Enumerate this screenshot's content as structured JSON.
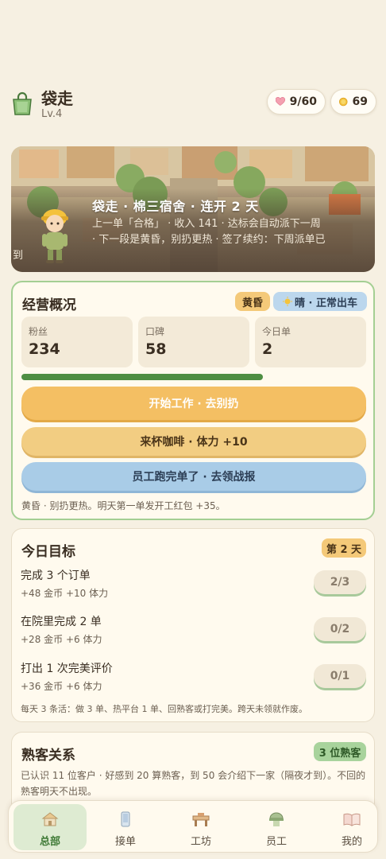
{
  "header": {
    "title": "袋走",
    "level": "Lv.4",
    "hearts": "9/60",
    "coins": "69"
  },
  "hero": {
    "title": "袋走 · 棉三宿舍 · 连开 2 天",
    "desc_line1": "上一单「合格」 · 收入 141 · 达标会自动派下一周",
    "desc_line2": "· 下一段是黄昏，别扔更热 · 签了续约：下周派单已",
    "desc_line3": "到"
  },
  "overview": {
    "title": "经营概况",
    "time_tag": "黄昏",
    "weather_tag": "晴 · 正常出车",
    "stats": [
      {
        "label": "粉丝",
        "value": "234"
      },
      {
        "label": "口碑",
        "value": "58"
      },
      {
        "label": "今日单",
        "value": "2"
      }
    ],
    "progress": 0.7,
    "start_button": "开始工作 · 去别扔",
    "coffee_button": "来杯咖啡 · 体力 +10",
    "staff_button": "员工跑完单了 · 去领战报",
    "note": "黄昏 · 别扔更热。明天第一单发开工红包 +35。"
  },
  "goals": {
    "title": "今日目标",
    "day_tag": "第 2 天",
    "items": [
      {
        "name": "完成 3 个订单",
        "reward": "+48 金币 +10 体力",
        "progress": "2/3"
      },
      {
        "name": "在院里完成 2 单",
        "reward": "+28 金币 +6 体力",
        "progress": "0/2"
      },
      {
        "name": "打出 1 次完美评价",
        "reward": "+36 金币 +6 体力",
        "progress": "0/1"
      }
    ],
    "note": "每天 3 条活：做 3 单、热平台 1 单、回熟客或打完美。跨天未领就作废。"
  },
  "regulars": {
    "title": "熟客关系",
    "tag": "3 位熟客",
    "desc": "已认识 11 位客户 · 好感到 20 算熟客，到 50 会介绍下一家（隔夜才到）。不回的熟客明天不出现。"
  },
  "nav": [
    {
      "label": "总部",
      "icon": "hq-icon",
      "active": true
    },
    {
      "label": "接单",
      "icon": "phone-icon",
      "active": false
    },
    {
      "label": "工坊",
      "icon": "workbench-icon",
      "active": false
    },
    {
      "label": "员工",
      "icon": "staff-icon",
      "active": false
    },
    {
      "label": "我的",
      "icon": "book-icon",
      "active": false
    }
  ],
  "colors": {
    "background": "#f6f0e2",
    "card": "#fffaee",
    "accent_green": "#4e8e43",
    "button_orange": "#f4bf63",
    "button_blue": "#a9cce7"
  }
}
